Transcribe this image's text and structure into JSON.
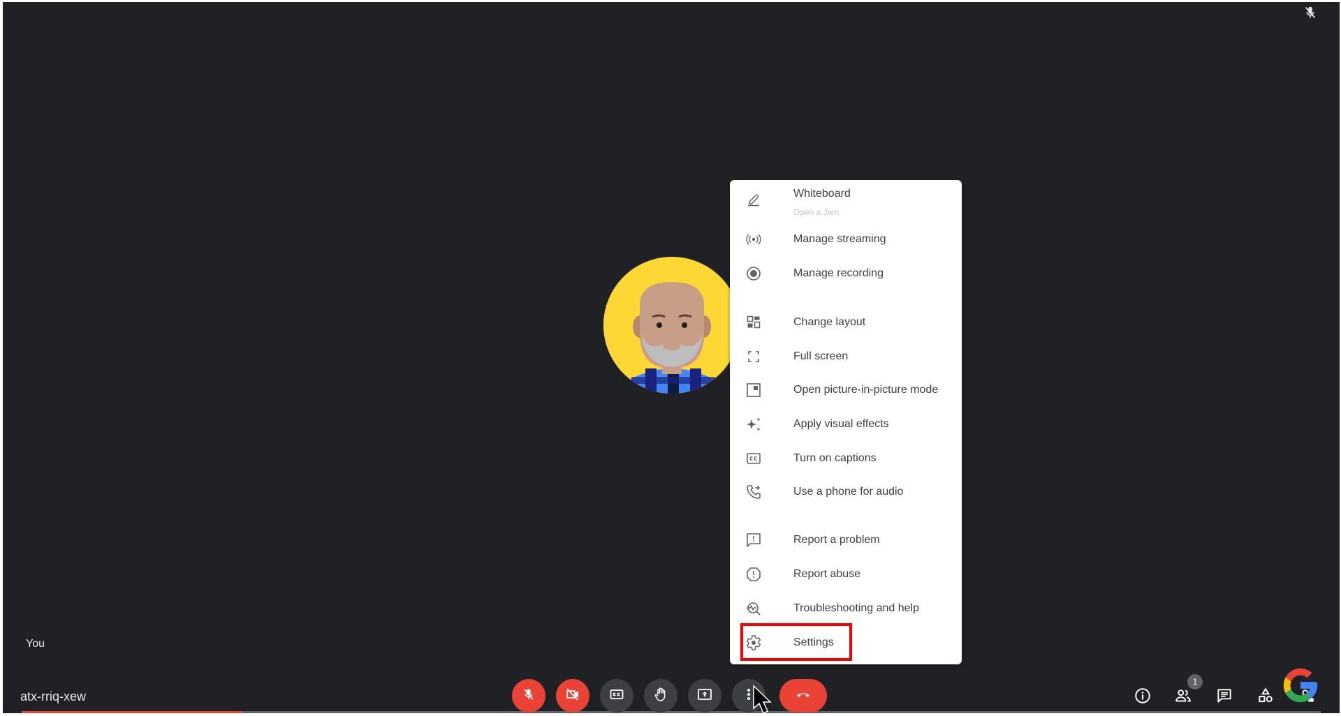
{
  "meeting": {
    "code": "atx-rriq-xew",
    "self_label": "You",
    "recording_progress": 0.17
  },
  "colors": {
    "background": "#202124",
    "danger": "#ea4335",
    "control_bg": "#3c4043",
    "menu_text": "#3c4043",
    "highlight": "#ff0000",
    "avatar_bg": "#fdd835"
  },
  "top_indicator": {
    "icon": "mic-off-icon"
  },
  "toolbar": {
    "controls": [
      {
        "id": "mic",
        "icon": "mic-off-icon",
        "state": "off"
      },
      {
        "id": "camera",
        "icon": "camera-off-icon",
        "state": "off"
      },
      {
        "id": "captions",
        "icon": "closed-captions-icon"
      },
      {
        "id": "raise-hand",
        "icon": "hand-icon"
      },
      {
        "id": "present",
        "icon": "present-screen-icon"
      },
      {
        "id": "more",
        "icon": "more-vert-icon",
        "state": "active"
      },
      {
        "id": "end-call",
        "icon": "phone-hangup-icon"
      }
    ],
    "right": [
      {
        "id": "info",
        "icon": "info-icon"
      },
      {
        "id": "people",
        "icon": "people-icon",
        "badge": "1"
      },
      {
        "id": "chat",
        "icon": "chat-icon"
      },
      {
        "id": "activities",
        "icon": "activities-icon"
      },
      {
        "id": "host-controls",
        "icon": "host-lock-icon"
      }
    ]
  },
  "menu": {
    "items": [
      {
        "label": "Whiteboard",
        "sublabel": "Open a Jam",
        "icon": "pencil-icon"
      },
      {
        "label": "Manage streaming",
        "icon": "streaming-icon"
      },
      {
        "label": "Manage recording",
        "icon": "record-icon"
      },
      {
        "label": "Change layout",
        "icon": "layout-icon"
      },
      {
        "label": "Full screen",
        "icon": "fullscreen-icon"
      },
      {
        "label": "Open picture-in-picture mode",
        "icon": "pip-icon"
      },
      {
        "label": "Apply visual effects",
        "icon": "sparkle-icon"
      },
      {
        "label": "Turn on captions",
        "icon": "captions-icon"
      },
      {
        "label": "Use a phone for audio",
        "icon": "phone-forward-icon"
      },
      {
        "label": "Report a problem",
        "icon": "feedback-icon"
      },
      {
        "label": "Report abuse",
        "icon": "report-icon"
      },
      {
        "label": "Troubleshooting and help",
        "icon": "troubleshoot-icon"
      },
      {
        "label": "Settings",
        "icon": "gear-icon",
        "highlighted": true
      }
    ]
  }
}
